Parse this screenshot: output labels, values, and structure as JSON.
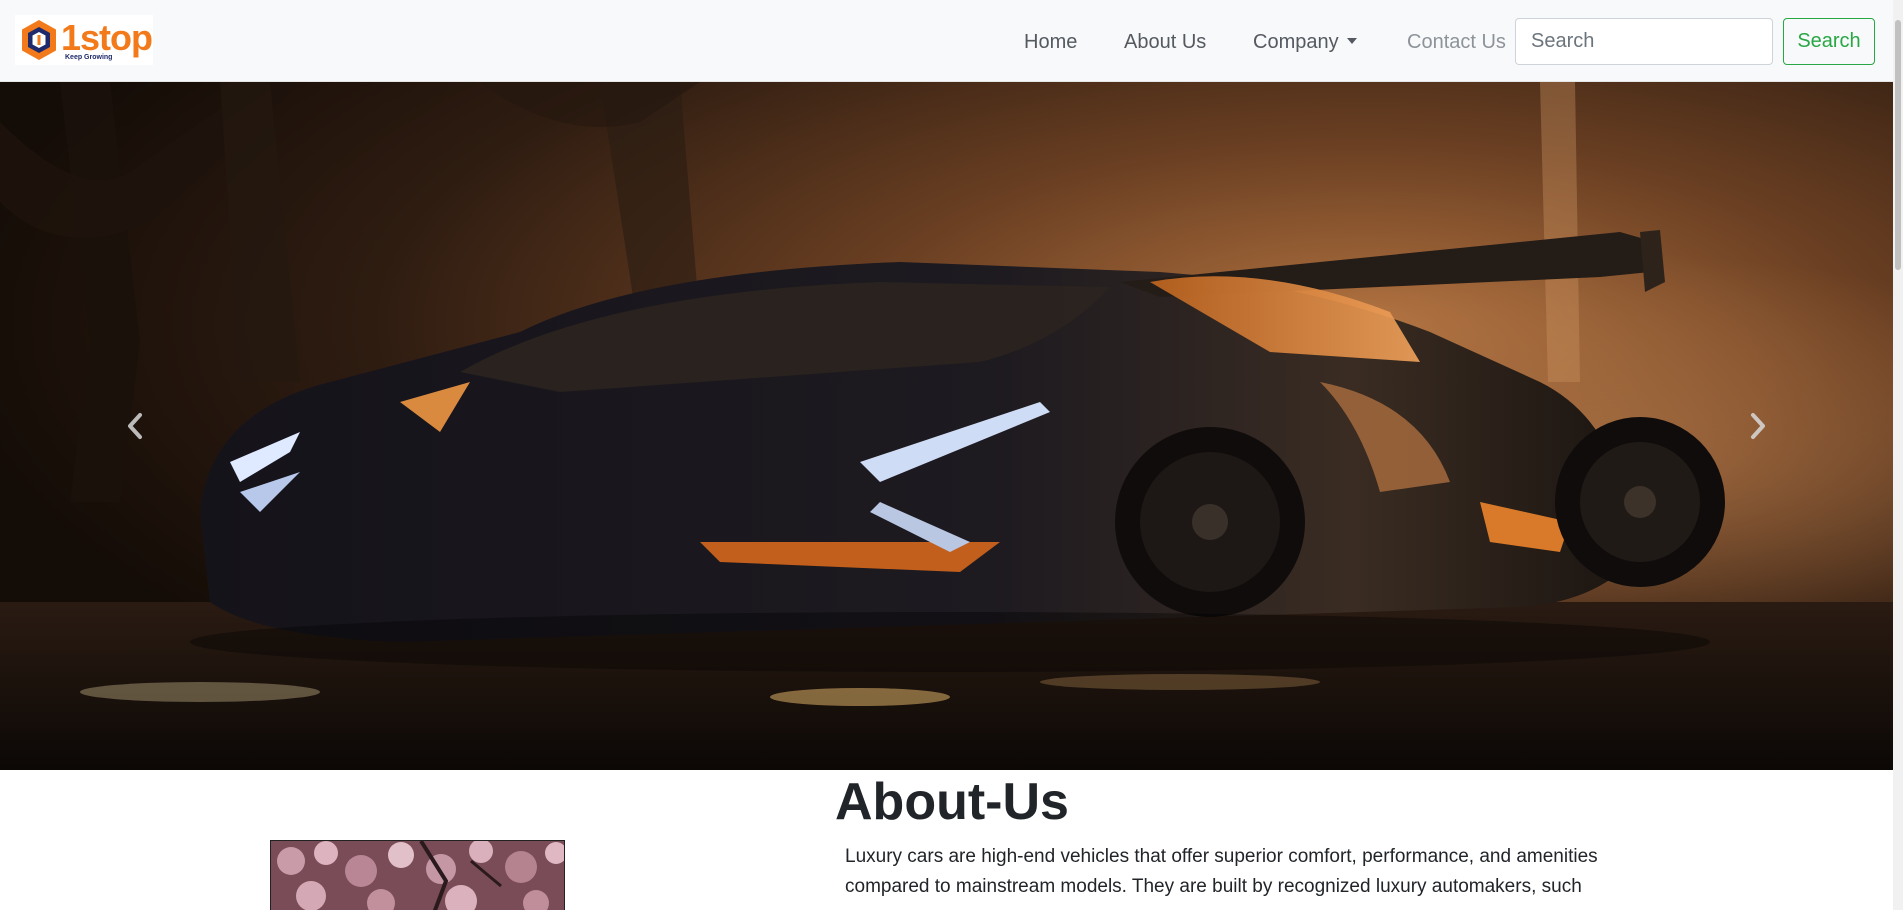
{
  "brand": {
    "name": "1stop",
    "tagline": "Keep Growing",
    "colors": {
      "orange": "#f27a1a",
      "navy": "#1f2a6b"
    }
  },
  "nav": {
    "links": [
      {
        "label": "Home"
      },
      {
        "label": "About Us"
      },
      {
        "label": "Company",
        "dropdown": true
      },
      {
        "label": "Contact Us",
        "muted": true
      }
    ]
  },
  "search": {
    "placeholder": "Search",
    "button_label": "Search",
    "accent": "#28a745"
  },
  "carousel": {
    "prev_icon": "chevron-left-icon",
    "next_icon": "chevron-right-icon",
    "slide_description_icon": "sports-car-image"
  },
  "about": {
    "title": "About-Us",
    "paragraph": "Luxury cars are high-end vehicles that offer superior comfort, performance, and amenities compared to mainstream models. They are built by recognized luxury automakers, such"
  }
}
